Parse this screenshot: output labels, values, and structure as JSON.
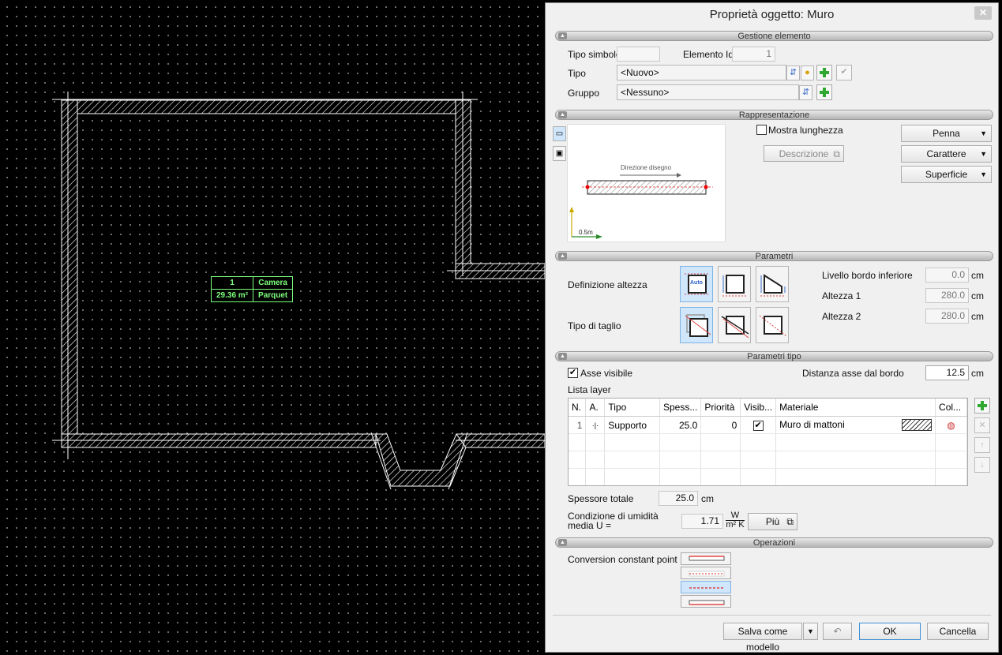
{
  "dialog": {
    "title": "Proprietà oggetto: Muro",
    "close_label": "✕"
  },
  "room_label": {
    "number": "1",
    "name": "Camera",
    "area": "29.36 m²",
    "floor": "Parquet"
  },
  "sections": {
    "gestione": "Gestione elemento",
    "rappresentazione": "Rappresentazione",
    "parametri": "Parametri",
    "parametri_tipo": "Parametri tipo",
    "operazioni": "Operazioni"
  },
  "gestione": {
    "tipo_simbolo_label": "Tipo simbolo",
    "tipo_simbolo_value": "",
    "elemento_id_label": "Elemento Id",
    "elemento_id_value": "1",
    "tipo_label": "Tipo",
    "tipo_value": "<Nuovo>",
    "gruppo_label": "Gruppo",
    "gruppo_value": "<Nessuno>"
  },
  "rappresentazione": {
    "mostra_lunghezza_label": "Mostra lunghezza",
    "mostra_lunghezza_checked": false,
    "descrizione_label": "Descrizione",
    "preview_direction_text": "Direzione disegno",
    "preview_scale_text": "0.5m",
    "penna_label": "Penna",
    "carattere_label": "Carattere",
    "superficie_label": "Superficie"
  },
  "parametri": {
    "definizione_altezza_label": "Definizione altezza",
    "tipo_di_taglio_label": "Tipo di taglio",
    "auto_text": "Auto",
    "livello_label": "Livello bordo inferiore",
    "livello_value": "0.0",
    "altezza1_label": "Altezza 1",
    "altezza1_value": "280.0",
    "altezza2_label": "Altezza 2",
    "altezza2_value": "280.0",
    "unit": "cm"
  },
  "parametri_tipo": {
    "asse_visibile_label": "Asse visibile",
    "asse_visibile_checked": true,
    "distanza_label": "Distanza asse dal bordo",
    "distanza_value": "12.5",
    "unit": "cm",
    "lista_layer_label": "Lista layer",
    "columns": [
      "N.",
      "A.",
      "Tipo",
      "Spess...",
      "Priorità",
      "Visib...",
      "Materiale",
      "Col..."
    ],
    "rows": [
      {
        "n": "1",
        "a": "·|·",
        "tipo": "Supporto",
        "spessore": "25.0",
        "priorita": "0",
        "visibile": "✔",
        "materiale": "Muro di mattoni",
        "colore": "◍"
      }
    ],
    "spessore_totale_label": "Spessore totale",
    "spessore_totale_value": "25.0",
    "condizione_label": "Condizione di umidità media U =",
    "u_value": "1.71",
    "u_unit_num": "W",
    "u_unit_den": "m² K",
    "piu_label": "Più"
  },
  "operazioni": {
    "conversion_label": "Conversion constant point"
  },
  "footer": {
    "salva_label": "Salva come modello",
    "ok_label": "OK",
    "cancella_label": "Cancella"
  },
  "colors": {
    "accent_green": "#2fa82f",
    "selection_blue": "#cfe6fb",
    "room_label_green": "#7dff7d"
  }
}
